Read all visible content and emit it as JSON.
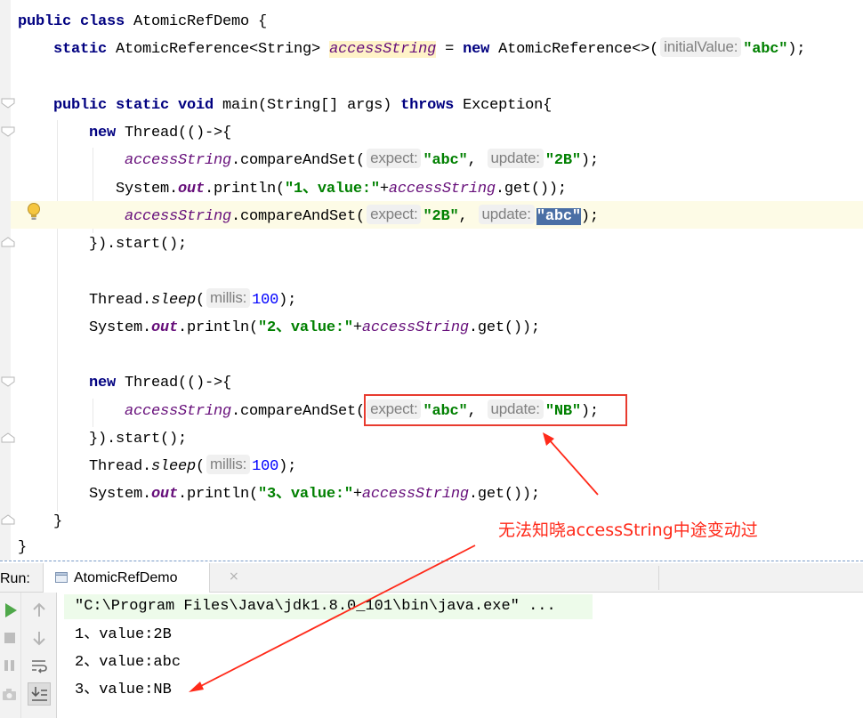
{
  "editor": {
    "lines": {
      "l1": {
        "a": "public class ",
        "b": "AtomicRefDemo {"
      },
      "l2": {
        "a": "static ",
        "b": "AtomicReference<String> ",
        "c": "accessString",
        "d": " = ",
        "e": "new ",
        "f": "AtomicReference<>(",
        "h": "initialValue:",
        "s": "\"abc\"",
        "z": ");"
      },
      "l4": {
        "a": "public static void ",
        "b": "main(String[] args) ",
        "c": "throws ",
        "d": "Exception{"
      },
      "l5": {
        "a": "new ",
        "b": "Thread(()->{"
      },
      "l6": {
        "f": "accessString",
        "m": ".compareAndSet(",
        "h1": "expect:",
        "s1": "\"abc\"",
        "c": ", ",
        "h2": "update:",
        "s2": "\"2B\"",
        "z": ");"
      },
      "l7": {
        "a": "System.",
        "o": "out",
        "b": ".println(",
        "s": "\"1、value:\"",
        "p": "+",
        "f": "accessString",
        "g": ".get());"
      },
      "l8": {
        "f": "accessString",
        "m": ".compareAndSet(",
        "h1": "expect:",
        "s1": "\"2B\"",
        "c": ", ",
        "h2": "update:",
        "s2": "\"abc\"",
        "z": ");"
      },
      "l9": {
        "a": "}).start();"
      },
      "l11": {
        "a": "Thread.",
        "i": "sleep",
        "b": "(",
        "h": "millis:",
        "n": "100",
        "z": ");"
      },
      "l12": {
        "a": "System.",
        "o": "out",
        "b": ".println(",
        "s": "\"2、value:\"",
        "p": "+",
        "f": "accessString",
        "g": ".get());"
      },
      "l14": {
        "a": "new ",
        "b": "Thread(()->{"
      },
      "l15": {
        "f": "accessString",
        "m": ".compareAndSet(",
        "h1": "expect:",
        "s1": "\"abc\"",
        "c": ", ",
        "h2": "update:",
        "s2": "\"NB\"",
        "z": ");"
      },
      "l16": {
        "a": "}).start();"
      },
      "l17": {
        "a": "Thread.",
        "i": "sleep",
        "b": "(",
        "h": "millis:",
        "n": "100",
        "z": ");"
      },
      "l18": {
        "a": "System.",
        "o": "out",
        "b": ".println(",
        "s": "\"3、value:\"",
        "p": "+",
        "f": "accessString",
        "g": ".get());"
      },
      "l19": {
        "a": "}"
      },
      "l20": {
        "a": "}"
      }
    },
    "annotation": "无法知晓accessString中途变动过"
  },
  "run_panel": {
    "label": "Run:",
    "tab_title": "AtomicRefDemo",
    "tab_close": "×",
    "output": [
      "\"C:\\Program Files\\Java\\jdk1.8.0_101\\bin\\java.exe\" ...",
      "1、value:2B",
      "2、value:abc",
      "3、value:NB"
    ]
  },
  "colors": {
    "keyword": "#000080",
    "field": "#660e7a",
    "string": "#008000",
    "number": "#0000ff",
    "annotation_red": "#ff2a1a",
    "selection": "#4a6fa5",
    "output_highlight": "#edfbea"
  },
  "icons": {
    "bulb": "lightbulb-icon",
    "run": "run-icon",
    "stop": "stop-icon",
    "pause": "pause-icon",
    "camera": "camera-icon",
    "up": "arrow-up-icon",
    "down": "arrow-down-icon",
    "softwrap": "soft-wrap-icon",
    "scroll": "scroll-to-end-icon",
    "tab": "java-class-icon"
  }
}
